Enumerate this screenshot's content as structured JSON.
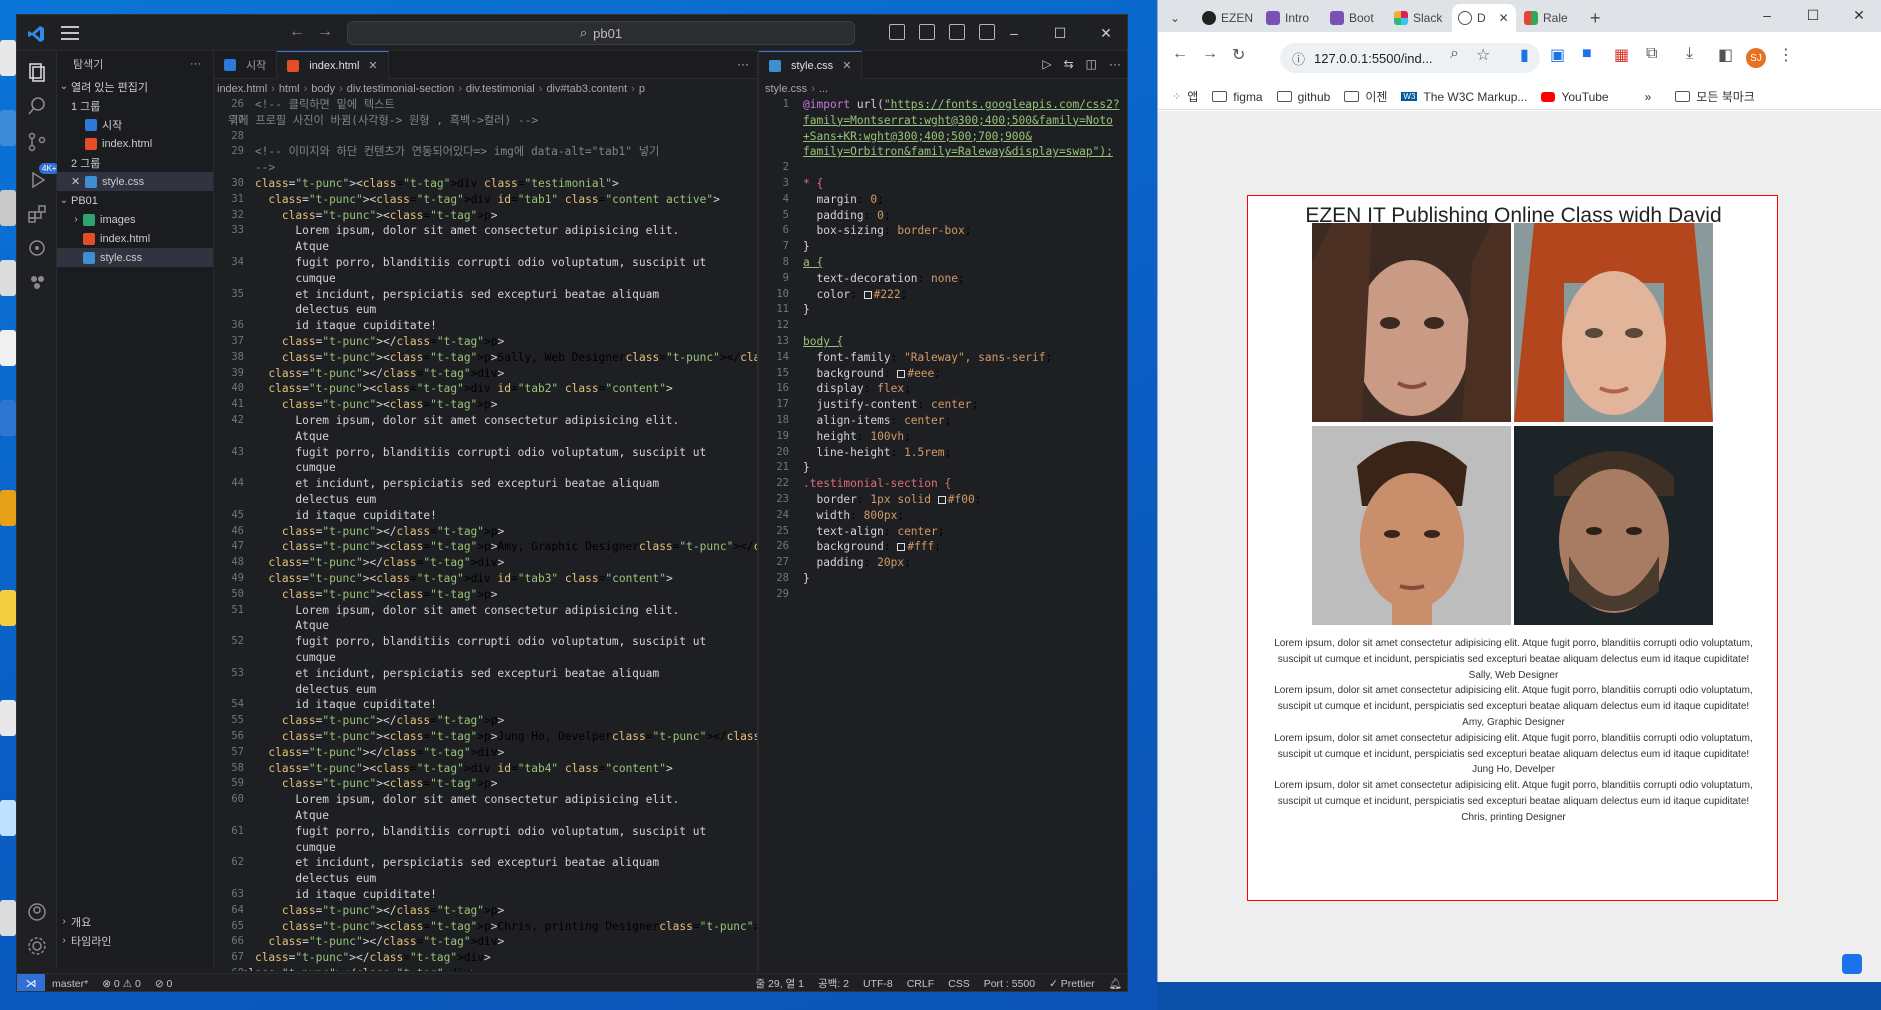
{
  "vscode": {
    "command_center": "pb01",
    "window_controls": [
      "–",
      "☐",
      "✕"
    ],
    "sidebar": {
      "title": "탐색기",
      "open_editors_label": "열려 있는 편집기",
      "group1_label": "1 그룹",
      "group1_files": [
        "시작",
        "index.html"
      ],
      "group2_label": "2 그룹",
      "group2_files": [
        "style.css"
      ],
      "project_label": "PB01",
      "project_items": [
        "images",
        "index.html",
        "style.css"
      ],
      "outline_label": "개요",
      "timeline_label": "타임라인"
    },
    "left_tabs": [
      "시작",
      "index.html"
    ],
    "right_tabs": [
      "style.css"
    ],
    "left_breadcrumb": [
      "index.html",
      "html",
      "body",
      "div.testimonial-section",
      "div.testimonial",
      "div#tab3.content",
      "p"
    ],
    "right_breadcrumb": [
      "style.css",
      "..."
    ],
    "html_lines": [
      {
        "n": "26",
        "text": "    <!-- 클릭하면 밑에 텍스트"
      },
      {
        "n": "27",
        "text": "위에 프로필 사진이 바뀜(사각형-> 원형 , 흑백->컬러) -->"
      },
      {
        "n": "28",
        "text": ""
      },
      {
        "n": "29",
        "text": "    <!-- 이미지와 하단 컨텐츠가 연동되어있다=> img에 data-alt=\"tab1\" 넣기"
      },
      {
        "n": "",
        "text": "    -->"
      },
      {
        "n": "30",
        "text": "    <div class=\"testimonial\">"
      },
      {
        "n": "31",
        "text": "      <div id=\"tab1\" class=\"content active\">"
      },
      {
        "n": "32",
        "text": "        <p>"
      },
      {
        "n": "33",
        "text": "          Lorem ipsum, dolor sit amet consectetur adipisicing elit."
      },
      {
        "n": "",
        "text": "          Atque"
      },
      {
        "n": "34",
        "text": "          fugit porro, blanditiis corrupti odio voluptatum, suscipit ut"
      },
      {
        "n": "",
        "text": "          cumque"
      },
      {
        "n": "35",
        "text": "          et incidunt, perspiciatis sed excepturi beatae aliquam"
      },
      {
        "n": "",
        "text": "          delectus eum"
      },
      {
        "n": "36",
        "text": "          id itaque cupiditate!"
      },
      {
        "n": "37",
        "text": "        </p>"
      },
      {
        "n": "38",
        "text": "        <p>Sally, Web Designer</p>"
      },
      {
        "n": "39",
        "text": "      </div>"
      },
      {
        "n": "40",
        "text": "      <div id=\"tab2\" class=\"content\">"
      },
      {
        "n": "41",
        "text": "        <p>"
      },
      {
        "n": "42",
        "text": "          Lorem ipsum, dolor sit amet consectetur adipisicing elit."
      },
      {
        "n": "",
        "text": "          Atque"
      },
      {
        "n": "43",
        "text": "          fugit porro, blanditiis corrupti odio voluptatum, suscipit ut"
      },
      {
        "n": "",
        "text": "          cumque"
      },
      {
        "n": "44",
        "text": "          et incidunt, perspiciatis sed excepturi beatae aliquam"
      },
      {
        "n": "",
        "text": "          delectus eum"
      },
      {
        "n": "45",
        "text": "          id itaque cupiditate!"
      },
      {
        "n": "46",
        "text": "        </p>"
      },
      {
        "n": "47",
        "text": "        <p>Amy, Graphic Designer</p>"
      },
      {
        "n": "48",
        "text": "      </div>"
      },
      {
        "n": "49",
        "text": "      <div id=\"tab3\" class=\"content\">"
      },
      {
        "n": "50",
        "text": "        <p>"
      },
      {
        "n": "51",
        "text": "          Lorem ipsum, dolor sit amet consectetur adipisicing elit."
      },
      {
        "n": "",
        "text": "          Atque"
      },
      {
        "n": "52",
        "text": "          fugit porro, blanditiis corrupti odio voluptatum, suscipit ut"
      },
      {
        "n": "",
        "text": "          cumque"
      },
      {
        "n": "53",
        "text": "          et incidunt, perspiciatis sed excepturi beatae aliquam"
      },
      {
        "n": "",
        "text": "          delectus eum"
      },
      {
        "n": "54",
        "text": "          id itaque cupiditate!"
      },
      {
        "n": "55",
        "text": "        </p>"
      },
      {
        "n": "56",
        "text": "        <p>Jung Ho, Develper</p>"
      },
      {
        "n": "57",
        "text": "      </div>"
      },
      {
        "n": "58",
        "text": "      <div id=\"tab4\" class=\"content\">"
      },
      {
        "n": "59",
        "text": "        <p>"
      },
      {
        "n": "60",
        "text": "          Lorem ipsum, dolor sit amet consectetur adipisicing elit."
      },
      {
        "n": "",
        "text": "          Atque"
      },
      {
        "n": "61",
        "text": "          fugit porro, blanditiis corrupti odio voluptatum, suscipit ut"
      },
      {
        "n": "",
        "text": "          cumque"
      },
      {
        "n": "62",
        "text": "          et incidunt, perspiciatis sed excepturi beatae aliquam"
      },
      {
        "n": "",
        "text": "          delectus eum"
      },
      {
        "n": "63",
        "text": "          id itaque cupiditate!"
      },
      {
        "n": "64",
        "text": "        </p>"
      },
      {
        "n": "65",
        "text": "        <p>Chris, printing Designer</p>"
      },
      {
        "n": "66",
        "text": "      </div>"
      },
      {
        "n": "67",
        "text": "    </div>"
      },
      {
        "n": "68",
        "text": "  </div>"
      }
    ],
    "css_lines": [
      {
        "n": "1",
        "text": "@import url(\"https://fonts.googleapis.com/css2?"
      },
      {
        "n": "",
        "text": "family=Montserrat:wght@300;400;500&family=Noto"
      },
      {
        "n": "",
        "text": "+Sans+KR:wght@300;400;500;700;900&"
      },
      {
        "n": "",
        "text": "family=Orbitron&family=Raleway&display=swap\");"
      },
      {
        "n": "2",
        "text": ""
      },
      {
        "n": "3",
        "text": "* {"
      },
      {
        "n": "4",
        "text": "  margin: 0;"
      },
      {
        "n": "5",
        "text": "  padding: 0;"
      },
      {
        "n": "6",
        "text": "  box-sizing: border-box;"
      },
      {
        "n": "7",
        "text": "}"
      },
      {
        "n": "8",
        "text": "a {"
      },
      {
        "n": "9",
        "text": "  text-decoration: none;"
      },
      {
        "n": "10",
        "text": "  color: □#222;"
      },
      {
        "n": "11",
        "text": "}"
      },
      {
        "n": "12",
        "text": ""
      },
      {
        "n": "13",
        "text": "body {"
      },
      {
        "n": "14",
        "text": "  font-family: \"Raleway\", sans-serif;"
      },
      {
        "n": "15",
        "text": "  background: □#eee;"
      },
      {
        "n": "16",
        "text": "  display: flex;"
      },
      {
        "n": "17",
        "text": "  justify-content: center;"
      },
      {
        "n": "18",
        "text": "  align-items: center;"
      },
      {
        "n": "19",
        "text": "  height: 100vh;"
      },
      {
        "n": "20",
        "text": "  line-height: 1.5rem;"
      },
      {
        "n": "21",
        "text": "}"
      },
      {
        "n": "22",
        "text": ".testimonial-section {"
      },
      {
        "n": "23",
        "text": "  border: 1px solid □#f00;"
      },
      {
        "n": "24",
        "text": "  width: 800px;"
      },
      {
        "n": "25",
        "text": "  text-align: center;"
      },
      {
        "n": "26",
        "text": "  background: □#fff;"
      },
      {
        "n": "27",
        "text": "  padding: 20px;"
      },
      {
        "n": "28",
        "text": "}"
      },
      {
        "n": "29",
        "text": ""
      }
    ],
    "status": {
      "branch": "master*",
      "problems": "⊗ 0 ⚠ 0",
      "ports": "⊘ 0",
      "cursor": "줄 29, 열 1",
      "spaces": "공백: 2",
      "encoding": "UTF-8",
      "eol": "CRLF",
      "language": "CSS",
      "port": "Port : 5500",
      "prettier": "✓ Prettier"
    }
  },
  "chrome": {
    "tabs": [
      "EZEN",
      "Intro",
      "Boot",
      "Slack",
      "D",
      "Rale"
    ],
    "address": "127.0.0.1:5500/ind...",
    "profile_initial": "SJ",
    "bookmarks": [
      "앱",
      "figma",
      "github",
      "이젠",
      "The W3C Markup...",
      "YouTube",
      "모든 북마크"
    ],
    "page": {
      "title": "EZEN IT Publishing Online Class widh David",
      "lorem": "Lorem ipsum, dolor sit amet consectetur adipisicing elit. Atque fugit porro, blanditiis corrupti odio voluptatum, suscipit ut cumque et incidunt, perspiciatis sed excepturi beatae aliquam delectus eum id itaque cupiditate!",
      "names": [
        "Sally, Web Designer",
        "Amy, Graphic Designer",
        "Jung Ho, Develper",
        "Chris, printing Designer"
      ]
    }
  },
  "colors": {
    "vscode_bg": "#1e1f22",
    "accent": "#2f6fd6",
    "testimonial_border": "#ff0000",
    "page_bg": "#eeeeee"
  }
}
